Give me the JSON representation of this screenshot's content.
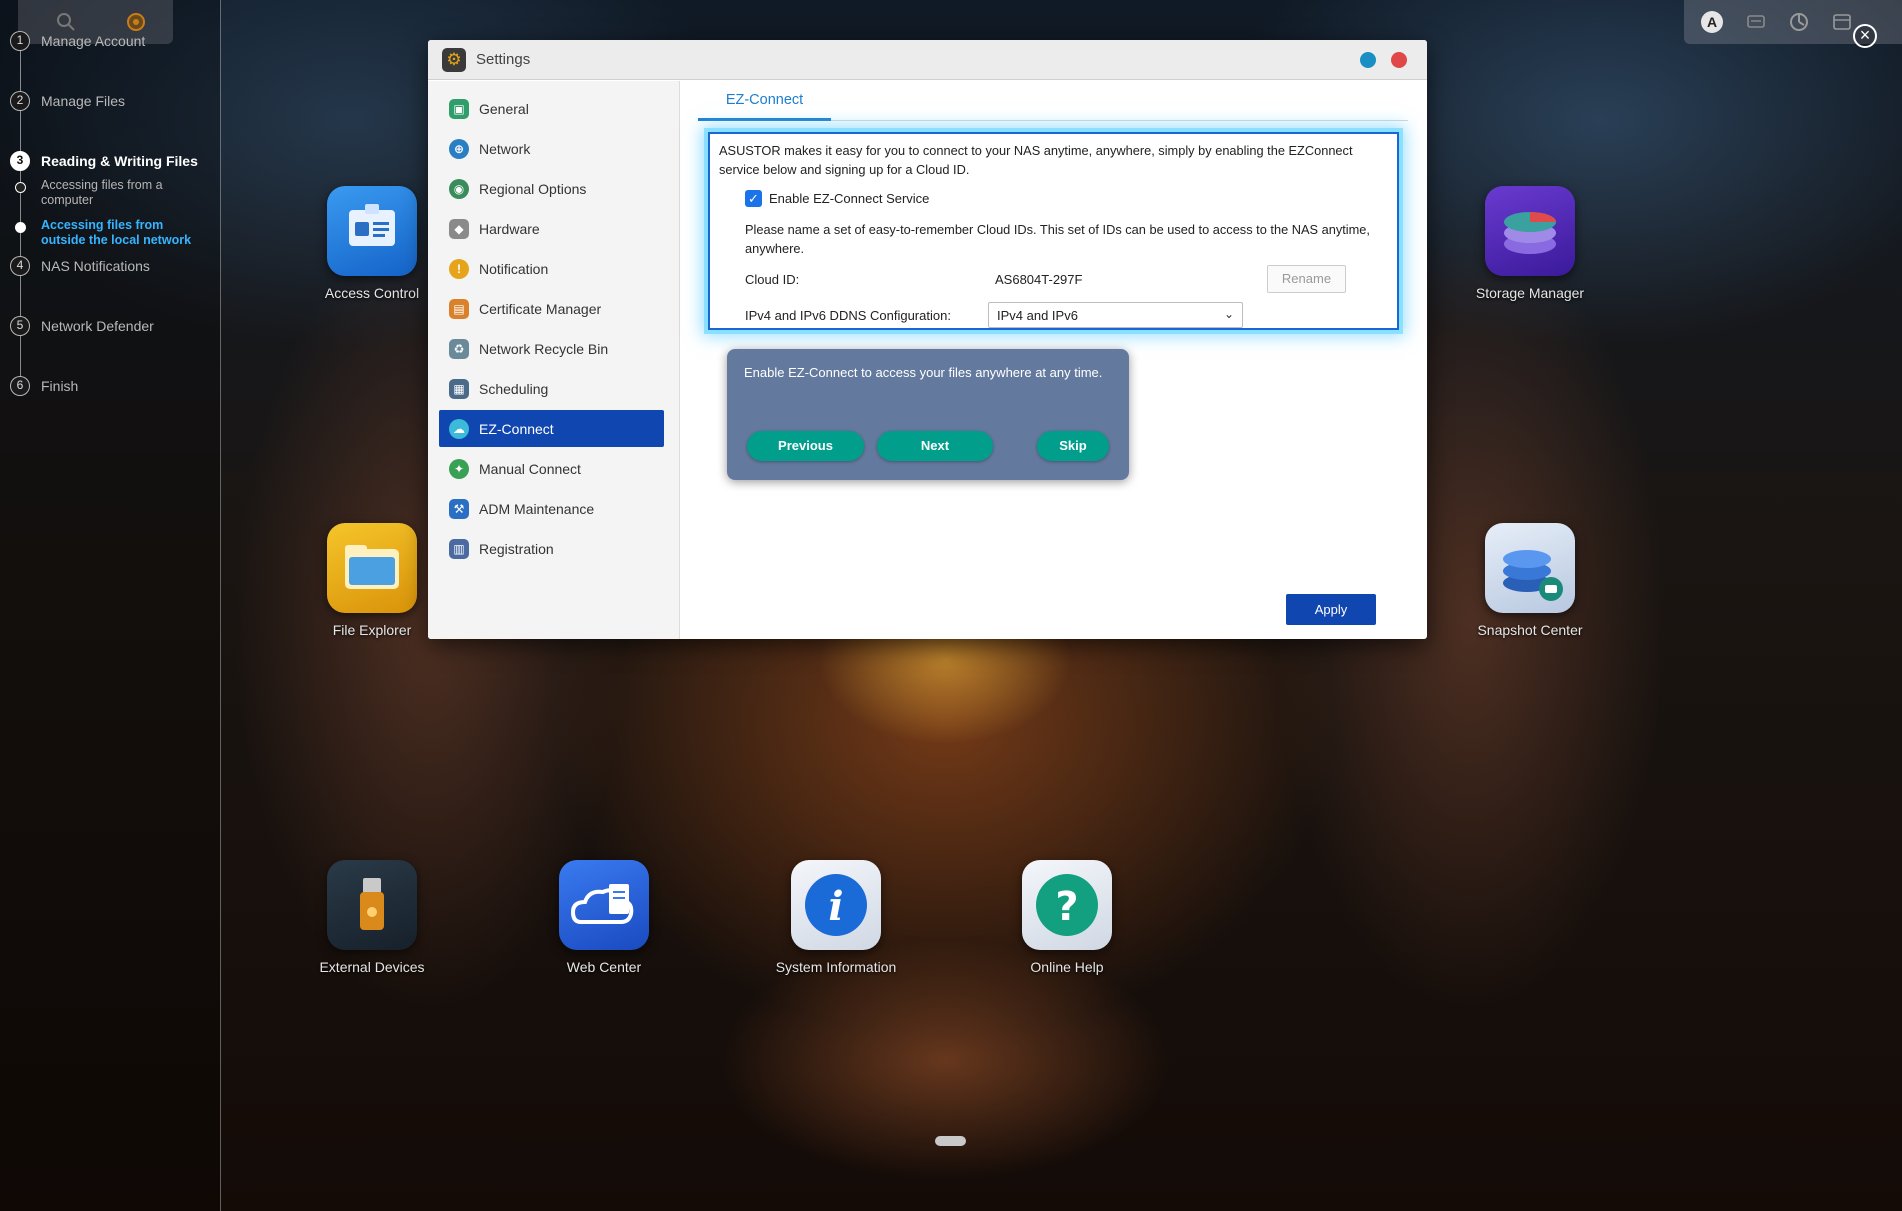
{
  "guide": {
    "steps": [
      {
        "num": "1",
        "label": "Manage Account"
      },
      {
        "num": "2",
        "label": "Manage Files"
      },
      {
        "num": "3",
        "label": "Reading & Writing Files"
      },
      {
        "num": "4",
        "label": "NAS Notifications"
      },
      {
        "num": "5",
        "label": "Network Defender"
      },
      {
        "num": "6",
        "label": "Finish"
      }
    ],
    "substeps": [
      {
        "label": "Accessing files from a computer",
        "active": false
      },
      {
        "label": "Accessing files from outside the local network",
        "active": true
      }
    ],
    "active_step": "3"
  },
  "tray": {
    "user_initial": "A",
    "close_glyph": "×"
  },
  "desktop_icons": [
    {
      "name": "access-control",
      "label": "Access Control"
    },
    {
      "name": "storage-manager",
      "label": "Storage Manager"
    },
    {
      "name": "file-explorer",
      "label": "File Explorer"
    },
    {
      "name": "snapshot-center",
      "label": "Snapshot Center"
    },
    {
      "name": "external-devices",
      "label": "External Devices"
    },
    {
      "name": "web-center",
      "label": "Web Center"
    },
    {
      "name": "system-information",
      "label": "System Information"
    },
    {
      "name": "online-help",
      "label": "Online Help"
    }
  ],
  "window": {
    "title": "Settings",
    "sidebar": [
      {
        "label": "General",
        "icon": "general-icon",
        "color": "#2f9e6a"
      },
      {
        "label": "Network",
        "icon": "network-icon",
        "color": "#2a7fc4"
      },
      {
        "label": "Regional Options",
        "icon": "regional-options-icon",
        "color": "#3a8c5c"
      },
      {
        "label": "Hardware",
        "icon": "hardware-icon",
        "color": "#8a8a8a"
      },
      {
        "label": "Notification",
        "icon": "notification-icon",
        "color": "#e6a41b"
      },
      {
        "label": "Certificate Manager",
        "icon": "certificate-icon",
        "color": "#d9822b"
      },
      {
        "label": "Network Recycle Bin",
        "icon": "recycle-bin-icon",
        "color": "#6a8a9a"
      },
      {
        "label": "Scheduling",
        "icon": "scheduling-icon",
        "color": "#4a6a8a"
      },
      {
        "label": "EZ-Connect",
        "icon": "ez-connect-icon",
        "color": "#3bbad9"
      },
      {
        "label": "Manual Connect",
        "icon": "manual-connect-icon",
        "color": "#3aa055"
      },
      {
        "label": "ADM Maintenance",
        "icon": "adm-maintenance-icon",
        "color": "#2a6fc4"
      },
      {
        "label": "Registration",
        "icon": "registration-icon",
        "color": "#4a6aa0"
      }
    ],
    "selected_item": "EZ-Connect",
    "tab": "EZ-Connect",
    "intro": "ASUSTOR makes it easy for you to connect to your NAS anytime, anywhere, simply by enabling the EZConnect service below and signing up for a Cloud ID.",
    "enable_label": "Enable EZ-Connect Service",
    "enable_checked": true,
    "cloud_desc": "Please name a set of easy-to-remember Cloud IDs. This set of IDs can be used to access to the NAS anytime, anywhere.",
    "cloud_id_label": "Cloud ID:",
    "cloud_id_value": "AS6804T-297F",
    "rename_label": "Rename",
    "ddns_label": "IPv4 and IPv6 DDNS Configuration:",
    "ddns_value": "IPv4 and IPv6",
    "apply_label": "Apply"
  },
  "tooltip": {
    "text": "Enable EZ-Connect to access your files anywhere at any time.",
    "previous": "Previous",
    "next": "Next",
    "skip": "Skip"
  },
  "colors": {
    "accent": "#1046b0",
    "tip_button": "#009e8b",
    "guide_active": "#35b4ff",
    "win_minimize": "#1a8fc4",
    "win_close": "#e04848"
  }
}
